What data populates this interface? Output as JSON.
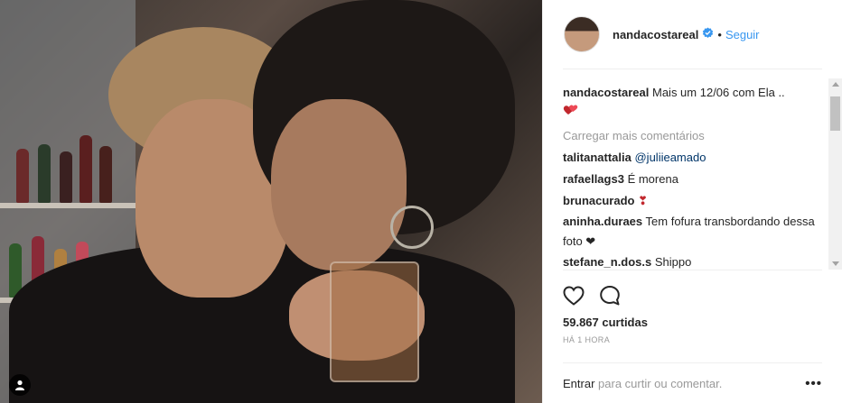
{
  "header": {
    "username": "nandacostareal",
    "verified_icon": "verified-badge-icon",
    "separator": "•",
    "follow_label": "Seguir"
  },
  "caption": {
    "username": "nandacostareal",
    "text": "Mais um 12/06 com Ela ..",
    "emoji": "heart-emoji"
  },
  "load_more_label": "Carregar mais comentários",
  "comments": [
    {
      "username": "talitanattalia",
      "mention": "@juliieamado",
      "text": ""
    },
    {
      "username": "rafaellags3",
      "text": "É morena"
    },
    {
      "username": "brunacurado",
      "text": "❣"
    },
    {
      "username": "aninha.duraes",
      "text": "Tem fofura transbordando dessa foto ❤"
    },
    {
      "username": "stefane_n.dos.s",
      "text": "Shippo"
    }
  ],
  "actions": {
    "like_icon": "heart-icon",
    "comment_icon": "comment-icon"
  },
  "likes_count": "59.867",
  "likes_label": "curtidas",
  "timestamp": "HÁ 1 HORA",
  "footer": {
    "login_label": "Entrar",
    "prompt": "para curtir ou comentar.",
    "more_label": "•••"
  },
  "colors": {
    "link_blue": "#3897f0",
    "mention_blue": "#003569",
    "muted_gray": "#999999",
    "heart_red": "#ed4956"
  }
}
